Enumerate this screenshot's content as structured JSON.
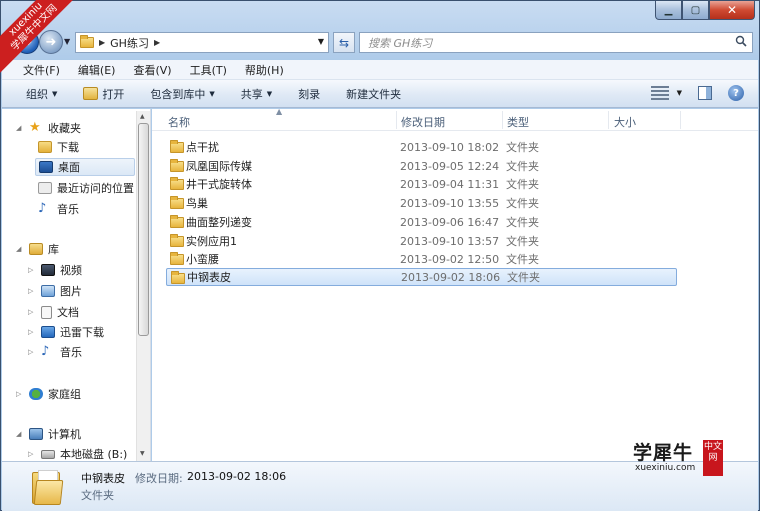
{
  "badge": {
    "line1": "xuexiniu",
    "line2": "学犀牛中文网"
  },
  "address": {
    "path_root_sep": "▶",
    "current": "GH练习",
    "tail_sep": "▶"
  },
  "search": {
    "placeholder": "搜索 GH练习"
  },
  "menu": [
    "文件(F)",
    "编辑(E)",
    "查看(V)",
    "工具(T)",
    "帮助(H)"
  ],
  "toolbar": {
    "organize": "组织",
    "open": "打开",
    "include": "包含到库中",
    "share": "共享",
    "burn": "刻录",
    "new_folder": "新建文件夹"
  },
  "nav": {
    "favorites": "收藏夹",
    "downloads": "下载",
    "desktop": "桌面",
    "recent": "最近访问的位置",
    "music_fav": "音乐",
    "libraries": "库",
    "videos": "视频",
    "pictures": "图片",
    "documents": "文档",
    "thunder": "迅雷下载",
    "music_lib": "音乐",
    "homegroup": "家庭组",
    "computer": "计算机",
    "local_disk": "本地磁盘 (B:)"
  },
  "columns": {
    "name": "名称",
    "date": "修改日期",
    "type": "类型",
    "size": "大小"
  },
  "files": [
    {
      "name": "点干扰",
      "date": "2013-09-10 18:02",
      "type": "文件夹"
    },
    {
      "name": "凤凰国际传媒",
      "date": "2013-09-05 12:24",
      "type": "文件夹"
    },
    {
      "name": "井干式旋转体",
      "date": "2013-09-04 11:31",
      "type": "文件夹"
    },
    {
      "name": "鸟巢",
      "date": "2013-09-10 13:55",
      "type": "文件夹"
    },
    {
      "name": "曲面整列递变",
      "date": "2013-09-06 16:47",
      "type": "文件夹"
    },
    {
      "name": "实例应用1",
      "date": "2013-09-10 13:57",
      "type": "文件夹"
    },
    {
      "name": "小蛮腰",
      "date": "2013-09-02 12:50",
      "type": "文件夹"
    },
    {
      "name": "中钢表皮",
      "date": "2013-09-02 18:06",
      "type": "文件夹"
    }
  ],
  "details": {
    "name": "中钢表皮",
    "date_label": "修改日期:",
    "date": "2013-09-02 18:06",
    "type": "文件夹"
  },
  "watermark": {
    "title": "学犀牛",
    "sub": "xuexiniu.com",
    "seal": "中文网"
  }
}
